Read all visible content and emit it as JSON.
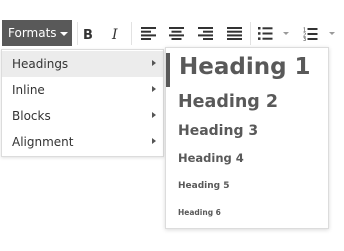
{
  "toolbar": {
    "formats_label": "Formats",
    "buttons": [
      "bold-icon",
      "italic-icon",
      "align-left-icon",
      "align-center-icon",
      "align-right-icon",
      "align-justify-icon",
      "bullet-list-icon",
      "numbered-list-icon"
    ]
  },
  "menu": {
    "items": [
      {
        "label": "Headings",
        "active": true
      },
      {
        "label": "Inline",
        "active": false
      },
      {
        "label": "Blocks",
        "active": false
      },
      {
        "label": "Alignment",
        "active": false
      }
    ]
  },
  "submenu": {
    "items": [
      {
        "label": "Heading 1",
        "level": 1
      },
      {
        "label": "Heading 2",
        "level": 2
      },
      {
        "label": "Heading 3",
        "level": 3
      },
      {
        "label": "Heading 4",
        "level": 4
      },
      {
        "label": "Heading 5",
        "level": 5
      },
      {
        "label": "Heading 6",
        "level": 6
      }
    ]
  },
  "colors": {
    "accent": "#595959",
    "hover": "#ececec",
    "text": "#333333"
  }
}
